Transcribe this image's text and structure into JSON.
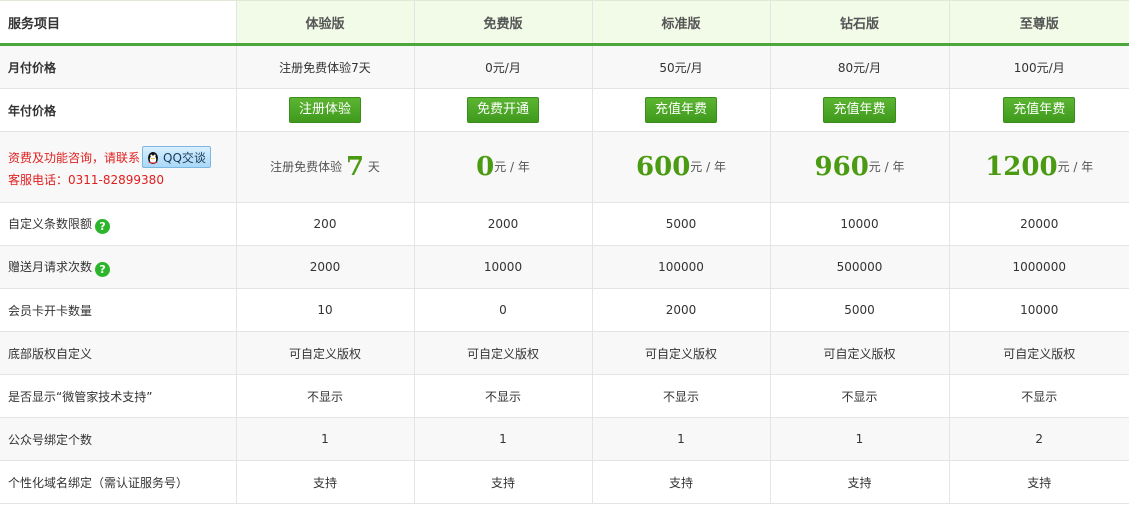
{
  "header": {
    "service_label": "服务项目",
    "plans": [
      "体验版",
      "免费版",
      "标准版",
      "钻石版",
      "至尊版"
    ]
  },
  "monthly": {
    "label": "月付价格",
    "values": [
      "注册免费体验7天",
      "0元/月",
      "50元/月",
      "80元/月",
      "100元/月"
    ]
  },
  "yearly": {
    "label": "年付价格",
    "buttons": [
      "注册体验",
      "免费开通",
      "充值年费",
      "充值年费",
      "充值年费"
    ]
  },
  "promo": {
    "consult_text": "资费及功能咨询，请联系",
    "qq_label": "QQ交谈",
    "phone_text": "客服电话：0311-82899380",
    "trial_prefix": "注册免费体验",
    "trial_days": "7",
    "trial_suffix": "天",
    "prices": [
      {
        "value": "0",
        "unit": "元 / 年"
      },
      {
        "value": "600",
        "unit": "元 / 年"
      },
      {
        "value": "960",
        "unit": "元 / 年"
      },
      {
        "value": "1200",
        "unit": "元 / 年"
      }
    ]
  },
  "rows": [
    {
      "label": "自定义条数限额",
      "help": true,
      "values": [
        "200",
        "2000",
        "5000",
        "10000",
        "20000"
      ]
    },
    {
      "label": "赠送月请求次数",
      "help": true,
      "values": [
        "2000",
        "10000",
        "100000",
        "500000",
        "1000000"
      ]
    },
    {
      "label": "会员卡开卡数量",
      "help": false,
      "values": [
        "10",
        "0",
        "2000",
        "5000",
        "10000"
      ]
    },
    {
      "label": "底部版权自定义",
      "help": false,
      "values": [
        "可自定义版权",
        "可自定义版权",
        "可自定义版权",
        "可自定义版权",
        "可自定义版权"
      ]
    },
    {
      "label": "是否显示“微管家技术支持”",
      "help": false,
      "values": [
        "不显示",
        "不显示",
        "不显示",
        "不显示",
        "不显示"
      ]
    },
    {
      "label": "公众号绑定个数",
      "help": false,
      "values": [
        "1",
        "1",
        "1",
        "1",
        "2"
      ]
    },
    {
      "label": "个性化域名绑定（需认证服务号）",
      "help": false,
      "values": [
        "支持",
        "支持",
        "支持",
        "支持",
        "支持"
      ]
    }
  ],
  "help_glyph": "?",
  "colors": {
    "accent_green": "#4ba63c",
    "price_green": "#4a9a12",
    "alert_red": "#e02020"
  }
}
